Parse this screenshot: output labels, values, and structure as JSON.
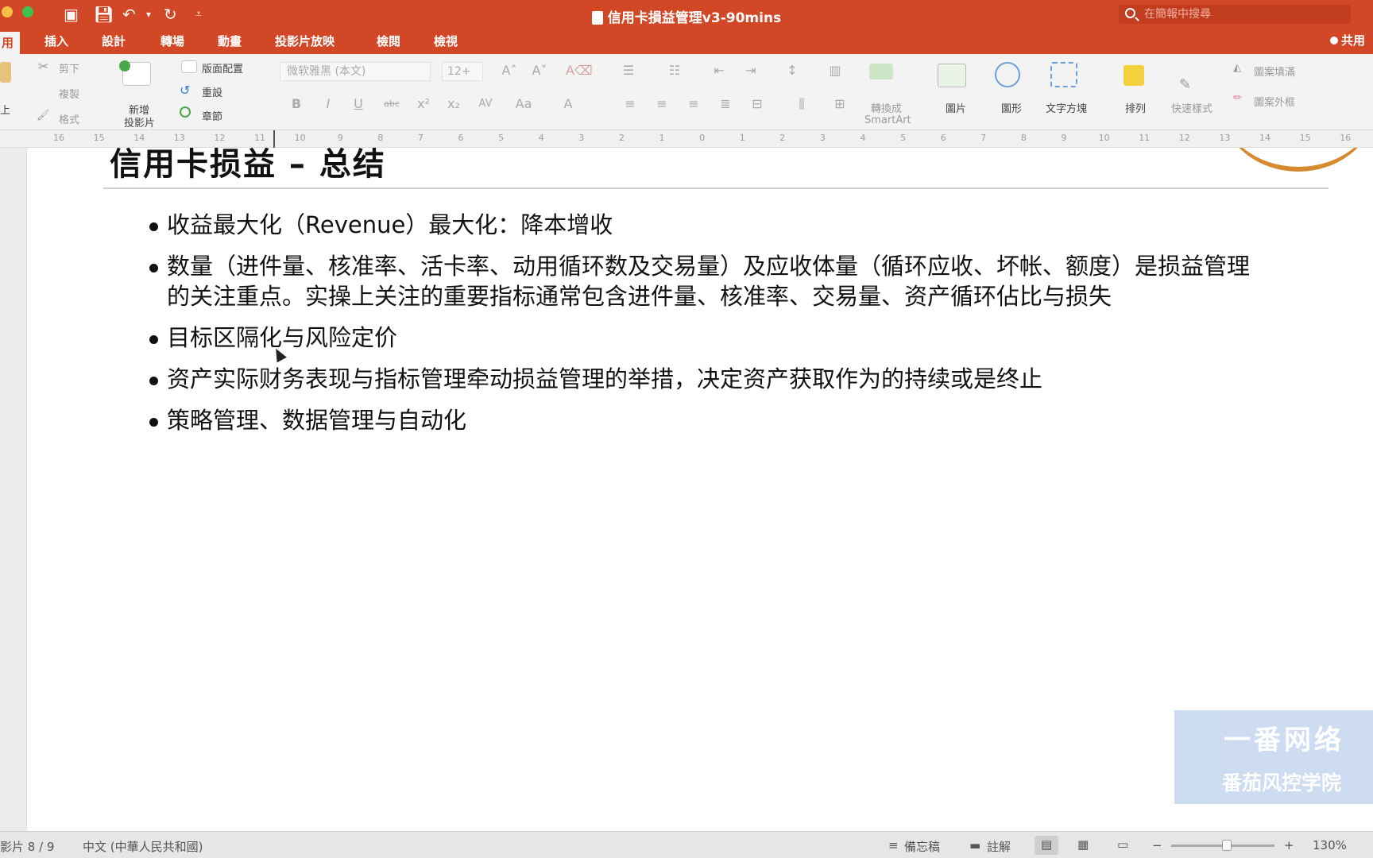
{
  "window": {
    "title": "信用卡損益管理v3-90mins",
    "search_placeholder": "在簡報中搜尋"
  },
  "ribbon_tabs": [
    {
      "label": "用",
      "active": true
    },
    {
      "label": "插入"
    },
    {
      "label": "設計"
    },
    {
      "label": "轉場"
    },
    {
      "label": "動畫"
    },
    {
      "label": "投影片放映"
    },
    {
      "label": "檢閱"
    },
    {
      "label": "檢視"
    }
  ],
  "share_label": "共用",
  "ribbon": {
    "paste_label": "上",
    "cut_label": "剪下",
    "copy_label": "複製",
    "format_label": "格式",
    "new_slide_label_1": "新增",
    "new_slide_label_2": "投影片",
    "layout_label": "版面配置",
    "reset_label": "重設",
    "section_label": "章節",
    "font_name": "微软雅黑 (本文)",
    "font_size": "12+",
    "smartart_label_1": "轉換成",
    "smartart_label_2": "SmartArt",
    "picture_label": "圖片",
    "shape_label": "圖形",
    "textbox_label": "文字方塊",
    "arrange_label": "排列",
    "quick_style_label": "快速樣式",
    "shape_fill_label": "圖案填滿",
    "shape_outline_label": "圖案外框"
  },
  "ruler_ticks": [
    "16",
    "15",
    "14",
    "13",
    "12",
    "11",
    "10",
    "9",
    "8",
    "7",
    "6",
    "5",
    "4",
    "3",
    "2",
    "1",
    "0",
    "1",
    "2",
    "3",
    "4",
    "5",
    "6",
    "7",
    "8",
    "9",
    "10",
    "11",
    "12",
    "13",
    "14",
    "15",
    "16"
  ],
  "slide": {
    "title": "信用卡损益 – 总结",
    "bullets": [
      "收益最大化（Revenue）最大化：降本增收",
      "数量（进件量、核准率、活卡率、动用循环数及交易量）及应收体量（循环应收、坏帐、额度）是损益管理的关注重点。实操上关注的重要指标通常包含进件量、核准率、交易量、资产循环佔比与损失",
      "目标区隔化与风险定价",
      "资产实际财务表现与指标管理牵动损益管理的举措，决定资产获取作为的持续或是终止",
      "策略管理、数据管理与自动化"
    ],
    "watermark_line1": "一番网络",
    "watermark_line2": "番茄风控学院"
  },
  "status": {
    "slide_position": "影片 8 / 9",
    "language": "中文 (中華人民共和國)",
    "notes_label": "備忘稿",
    "comments_label": "註解",
    "zoom_minus": "−",
    "zoom_plus": "+",
    "zoom_level": "130%"
  }
}
